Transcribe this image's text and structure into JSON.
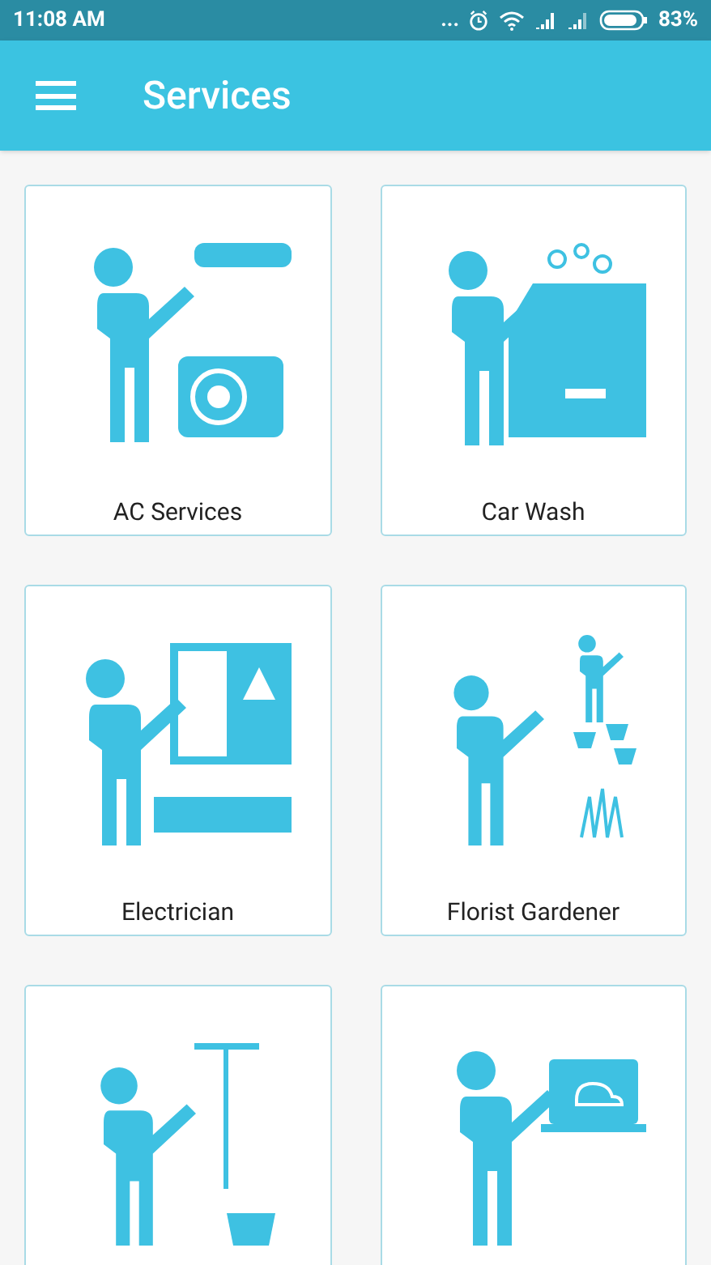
{
  "status_bar": {
    "time": "11:08 AM",
    "dots": "...",
    "battery": "83%"
  },
  "app_bar": {
    "title": "Services"
  },
  "services": [
    {
      "kind": "ac",
      "label": "AC Services"
    },
    {
      "kind": "carwash",
      "label": "Car Wash"
    },
    {
      "kind": "electrician",
      "label": "Electrician"
    },
    {
      "kind": "gardener",
      "label": "Florist Gardener"
    },
    {
      "kind": "cleaning"
    },
    {
      "kind": "computer"
    }
  ]
}
